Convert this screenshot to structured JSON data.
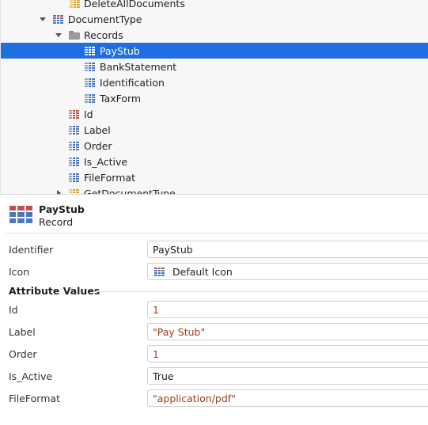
{
  "tree": {
    "items": [
      {
        "label": "DeleteAllDocuments",
        "caret": "none",
        "icon": "orange-grid",
        "selected": false
      },
      {
        "label": "DocumentType",
        "caret": "down",
        "icon": "entity-grid",
        "selected": false
      },
      {
        "label": "Records",
        "caret": "down",
        "icon": "folder",
        "selected": false
      },
      {
        "label": "PayStub",
        "caret": "none",
        "icon": "record-grid",
        "selected": true
      },
      {
        "label": "BankStatement",
        "caret": "none",
        "icon": "record-grid",
        "selected": false
      },
      {
        "label": "Identification",
        "caret": "none",
        "icon": "record-grid",
        "selected": false
      },
      {
        "label": "TaxForm",
        "caret": "none",
        "icon": "record-grid",
        "selected": false
      },
      {
        "label": "Id",
        "caret": "none",
        "icon": "key-attribute",
        "selected": false
      },
      {
        "label": "Label",
        "caret": "none",
        "icon": "attribute",
        "selected": false
      },
      {
        "label": "Order",
        "caret": "none",
        "icon": "attribute",
        "selected": false
      },
      {
        "label": "Is_Active",
        "caret": "none",
        "icon": "attribute",
        "selected": false
      },
      {
        "label": "FileFormat",
        "caret": "none",
        "icon": "attribute",
        "selected": false
      },
      {
        "label": "GetDocumentType",
        "caret": "right",
        "icon": "orange-grid",
        "selected": false
      }
    ]
  },
  "header": {
    "title": "PayStub",
    "subtitle": "Record",
    "icon": "record-icon"
  },
  "properties": {
    "identifier_label": "Identifier",
    "identifier_value": "PayStub",
    "icon_label": "Icon",
    "icon_value": "Default Icon",
    "section_title": "Attribute Values",
    "attributes": [
      {
        "label": "Id",
        "value": "1"
      },
      {
        "label": "Label",
        "value": "\"Pay Stub\""
      },
      {
        "label": "Order",
        "value": "1"
      },
      {
        "label": "Is_Active",
        "value": "True"
      },
      {
        "label": "FileFormat",
        "value": "\"application/pdf\""
      }
    ]
  }
}
